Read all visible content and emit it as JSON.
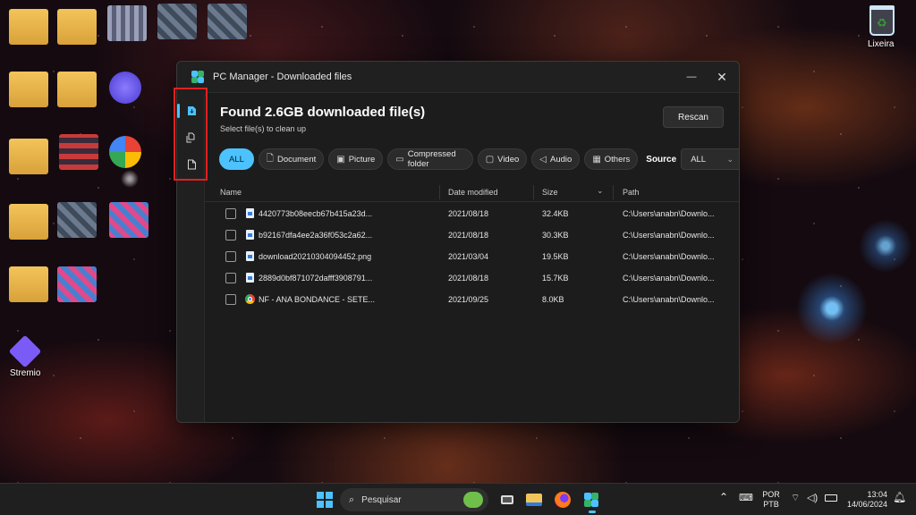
{
  "desktop": {
    "icons": [
      {
        "label": "Stremio"
      },
      {
        "label": "Lixeira"
      }
    ]
  },
  "window": {
    "title": "PC Manager - Downloaded files",
    "minimize_glyph": "—",
    "close_glyph": "✕"
  },
  "rail": {
    "items": [
      {
        "icon": "downloaded-files-icon",
        "active": true
      },
      {
        "icon": "duplicate-files-icon",
        "active": false
      },
      {
        "icon": "large-files-icon",
        "active": false
      }
    ]
  },
  "header": {
    "title": "Found 2.6GB downloaded file(s)",
    "subtitle": "Select file(s) to clean up",
    "rescan_label": "Rescan"
  },
  "filters": {
    "chips": [
      {
        "label": "ALL",
        "icon": "",
        "active": true
      },
      {
        "label": "Document",
        "icon": "document-icon"
      },
      {
        "label": "Picture",
        "icon": "picture-icon"
      },
      {
        "label": "Compressed folder",
        "icon": "folder-icon"
      },
      {
        "label": "Video",
        "icon": "video-icon"
      },
      {
        "label": "Audio",
        "icon": "audio-icon"
      },
      {
        "label": "Others",
        "icon": "others-icon"
      }
    ],
    "source_label": "Source",
    "source_value": "ALL"
  },
  "table": {
    "columns": [
      "Name",
      "Date modified",
      "Size",
      "Path"
    ],
    "rows": [
      {
        "name": "4420773b08eecb67b415a23d...",
        "date": "2021/08/18",
        "size": "32.4KB",
        "path": "C:\\Users\\anabn\\Downlo...",
        "icon": "file-icon"
      },
      {
        "name": "b92167dfa4ee2a36f053c2a62...",
        "date": "2021/08/18",
        "size": "30.3KB",
        "path": "C:\\Users\\anabn\\Downlo...",
        "icon": "file-icon"
      },
      {
        "name": "download20210304094452.png",
        "date": "2021/03/04",
        "size": "19.5KB",
        "path": "C:\\Users\\anabn\\Downlo...",
        "icon": "file-icon"
      },
      {
        "name": "2889d0bf871072dafff3908791...",
        "date": "2021/08/18",
        "size": "15.7KB",
        "path": "C:\\Users\\anabn\\Downlo...",
        "icon": "file-icon"
      },
      {
        "name": "NF - ANA BONDANCE - SETE...",
        "date": "2021/09/25",
        "size": "8.0KB",
        "path": "C:\\Users\\anabn\\Downlo...",
        "icon": "chrome-icon"
      }
    ]
  },
  "taskbar": {
    "search_placeholder": "Pesquisar",
    "lang_top": "POR",
    "lang_bottom": "PTB",
    "time": "13:04",
    "date": "14/06/2024"
  }
}
